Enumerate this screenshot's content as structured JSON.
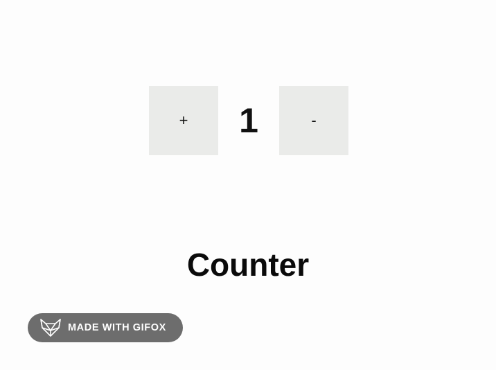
{
  "counter": {
    "increment_label": "+",
    "value": "1",
    "decrement_label": "-"
  },
  "title": "Counter",
  "badge": {
    "text": "MADE WITH GIFOX",
    "icon": "fox-logo-icon"
  },
  "colors": {
    "background": "#fdfdfd",
    "button_bg": "#eaebe9",
    "badge_bg": "#6d6d6d"
  }
}
